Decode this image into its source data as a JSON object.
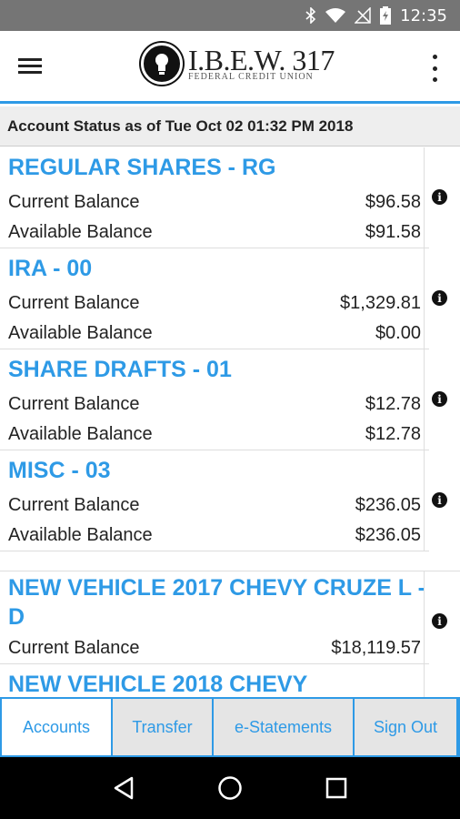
{
  "status_bar": {
    "time": "12:35"
  },
  "header": {
    "logo_line1": "I.B.E.W. 317",
    "logo_line2": "FEDERAL CREDIT UNION"
  },
  "account_status": "Account Status as of Tue Oct 02 01:32 PM 2018",
  "accounts": [
    {
      "name": "REGULAR SHARES - RG",
      "current_label": "Current Balance",
      "current": "$96.58",
      "available_label": "Available Balance",
      "available": "$91.58"
    },
    {
      "name": "IRA - 00",
      "current_label": "Current Balance",
      "current": "$1,329.81",
      "available_label": "Available Balance",
      "available": "$0.00"
    },
    {
      "name": "SHARE DRAFTS - 01",
      "current_label": "Current Balance",
      "current": "$12.78",
      "available_label": "Available Balance",
      "available": "$12.78"
    },
    {
      "name": "MISC - 03",
      "current_label": "Current Balance",
      "current": "$236.05",
      "available_label": "Available Balance",
      "available": "$236.05"
    }
  ],
  "loans": [
    {
      "name": "NEW VEHICLE 2017 CHEVY CRUZE L - D",
      "current_label": "Current Balance",
      "current": "$18,119.57"
    },
    {
      "name": "NEW VEHICLE 2018 CHEVY"
    }
  ],
  "tabs": [
    "Accounts",
    "Transfer",
    "e-Statements",
    "Sign Out"
  ],
  "colors": {
    "accent": "#2e9ae6",
    "status_bar": "#757575",
    "nav_bar": "#000000"
  }
}
